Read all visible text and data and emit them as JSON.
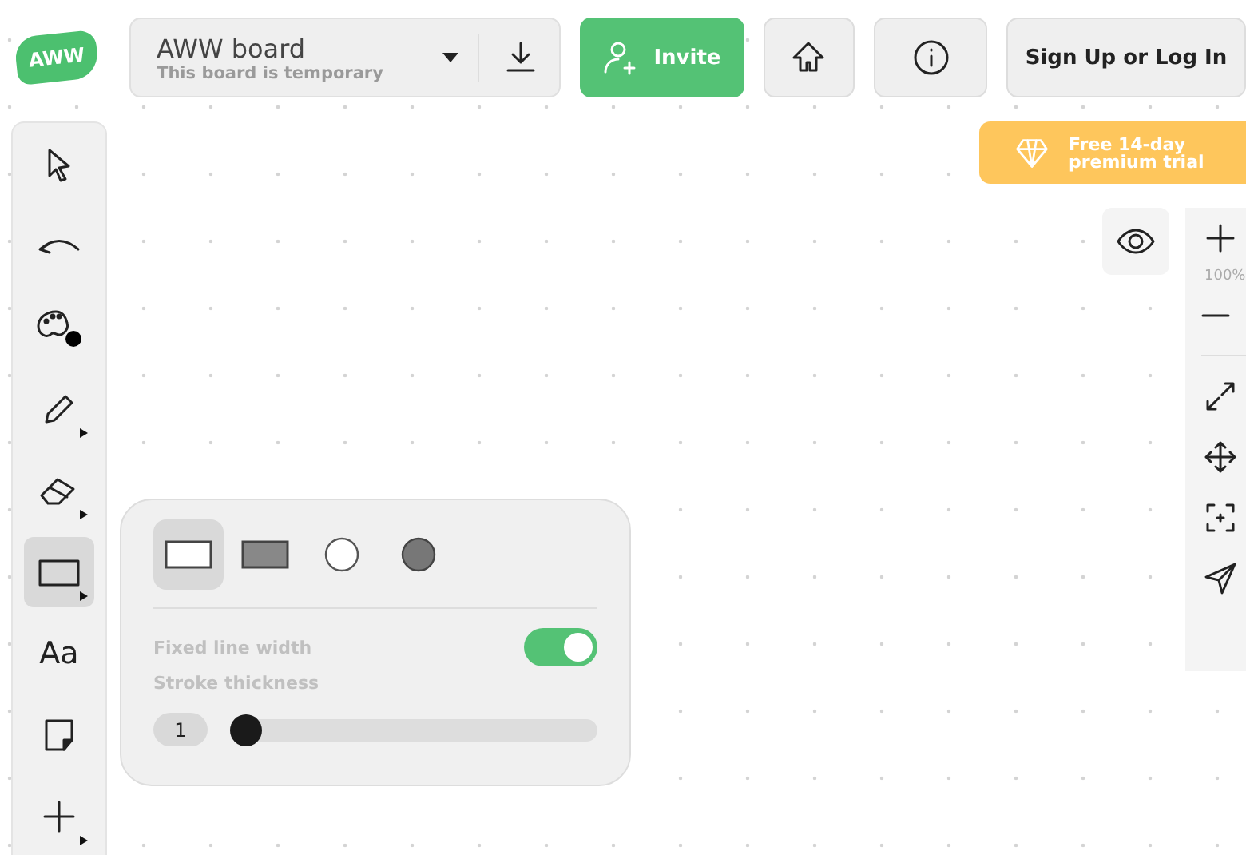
{
  "logo": {
    "text": "AWW"
  },
  "board": {
    "title": "AWW board",
    "subtitle": "This board is temporary"
  },
  "header_buttons": [
    {
      "kind": "invite",
      "label": "Invite"
    },
    {
      "kind": "home"
    },
    {
      "kind": "info"
    },
    {
      "kind": "signup",
      "label": "Sign Up or Log In"
    }
  ],
  "premium_banner": {
    "label": "Free 14-day premium trial"
  },
  "tools": [
    {
      "kind": "select",
      "selected": false,
      "submenu": false
    },
    {
      "kind": "undo",
      "selected": false,
      "submenu": false
    },
    {
      "kind": "color",
      "selected": false,
      "submenu": false
    },
    {
      "kind": "pencil",
      "selected": false,
      "submenu": true
    },
    {
      "kind": "eraser",
      "selected": false,
      "submenu": true
    },
    {
      "kind": "shape",
      "selected": true,
      "submenu": true
    },
    {
      "kind": "text",
      "label": "Aa",
      "selected": false,
      "submenu": false
    },
    {
      "kind": "sticky",
      "selected": false,
      "submenu": false
    },
    {
      "kind": "add",
      "selected": false,
      "submenu": true
    }
  ],
  "zoom": {
    "level": "100%"
  },
  "shape_panel": {
    "shapes": [
      {
        "kind": "rect-outline",
        "selected": true
      },
      {
        "kind": "rect-filled",
        "selected": false
      },
      {
        "kind": "circle-outline",
        "selected": false
      },
      {
        "kind": "circle-filled",
        "selected": false
      }
    ],
    "fixed_line_width": {
      "label": "Fixed line width",
      "on": true
    },
    "stroke_thickness": {
      "label": "Stroke thickness",
      "value": "1",
      "level": 0
    }
  }
}
